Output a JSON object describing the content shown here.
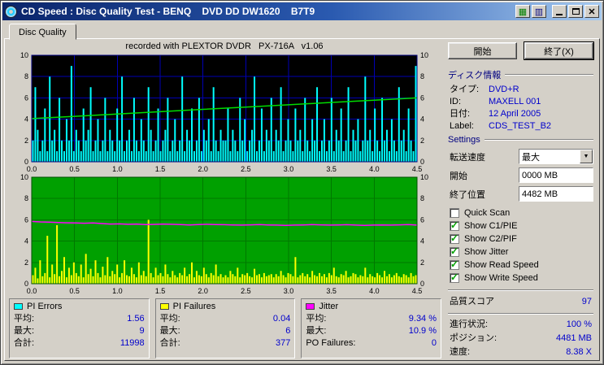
{
  "window": {
    "title": "CD Speed : Disc Quality Test - BENQ    DVD DD DW1620    B7T9"
  },
  "tab": {
    "label": "Disc Quality"
  },
  "recorded_with": "recorded with PLEXTOR DVDR   PX-716A   v1.06",
  "buttons": {
    "start": "開始",
    "exit": "終了(X)"
  },
  "disc_info": {
    "header": "ディスク情報",
    "rows": [
      {
        "label": "タイプ:",
        "value": "DVD+R"
      },
      {
        "label": "ID:",
        "value": "MAXELL 001"
      },
      {
        "label": "日付:",
        "value": "12 April 2005"
      },
      {
        "label": "Label:",
        "value": "CDS_TEST_B2"
      }
    ]
  },
  "settings": {
    "header": "Settings",
    "transfer_speed_label": "転送速度",
    "transfer_speed_value": "最大",
    "start_label": "開始",
    "start_value": "0000 MB",
    "end_label": "終了位置",
    "end_value": "4482 MB",
    "checkboxes": [
      {
        "label": "Quick Scan",
        "checked": false
      },
      {
        "label": "Show C1/PIE",
        "checked": true
      },
      {
        "label": "Show C2/PIF",
        "checked": true
      },
      {
        "label": "Show Jitter",
        "checked": true
      },
      {
        "label": "Show Read Speed",
        "checked": true
      },
      {
        "label": "Show Write Speed",
        "checked": true
      }
    ]
  },
  "score": {
    "label": "品質スコア",
    "value": "97"
  },
  "status": [
    {
      "label": "進行状況:",
      "value": "100 %"
    },
    {
      "label": "ポジション:",
      "value": "4481 MB"
    },
    {
      "label": "速度:",
      "value": "8.38 X"
    }
  ],
  "legend": {
    "boxes": [
      {
        "name": "PI Errors",
        "swatch": "#00ffff",
        "rows": [
          {
            "label": "平均:",
            "value": "1.56"
          },
          {
            "label": "最大:",
            "value": "9"
          },
          {
            "label": "合計:",
            "value": "11998"
          }
        ]
      },
      {
        "name": "PI Failures",
        "swatch": "#ffff00",
        "rows": [
          {
            "label": "平均:",
            "value": "0.04"
          },
          {
            "label": "最大:",
            "value": "6"
          },
          {
            "label": "合計:",
            "value": "377"
          }
        ]
      },
      {
        "name": "Jitter",
        "swatch": "#ff00ff",
        "rows": [
          {
            "label": "平均:",
            "value": "9.34 %"
          },
          {
            "label": "最大:",
            "value": "10.9 %"
          },
          {
            "label": "PO Failures:",
            "value": "0"
          }
        ]
      }
    ]
  },
  "chart_data": [
    {
      "type": "bar",
      "xlim": [
        0,
        4.5
      ],
      "ylim": [
        0,
        10
      ],
      "xticks": [
        "0.0",
        "0.5",
        "1.0",
        "1.5",
        "2.0",
        "2.5",
        "3.0",
        "3.5",
        "4.0",
        "4.5"
      ],
      "yticks": [
        0,
        2,
        4,
        6,
        8,
        10
      ],
      "bg": "#000000",
      "grid": "#0000b4",
      "border": "#000080",
      "series": [
        {
          "name": "PI Errors",
          "type": "bars",
          "color": "#00ffff",
          "values": [
            2,
            7,
            3,
            1,
            2,
            5,
            1,
            8,
            2,
            3,
            1,
            6,
            2,
            1,
            4,
            2,
            9,
            1,
            3,
            2,
            1,
            5,
            2,
            3,
            7,
            1,
            2,
            4,
            1,
            2,
            6,
            1,
            3,
            2,
            1,
            5,
            2,
            8,
            1,
            2,
            3,
            1,
            6,
            2,
            1,
            4,
            2,
            1,
            7,
            3,
            1,
            2,
            5,
            1,
            2,
            3,
            6,
            1,
            2,
            4,
            1,
            2,
            8,
            1,
            3,
            2,
            5,
            1,
            2,
            6,
            1,
            3,
            2,
            4,
            1,
            7,
            2,
            1,
            3,
            2,
            2,
            5,
            1,
            3,
            2,
            1,
            6,
            2,
            4,
            1,
            2,
            3,
            8,
            1,
            2,
            5,
            1,
            3,
            2,
            6,
            1,
            3,
            2,
            7,
            1,
            2,
            4,
            2,
            1,
            5,
            2,
            3,
            1,
            6,
            2,
            1,
            4,
            2,
            7,
            1,
            2,
            4,
            1,
            2,
            6,
            1,
            3,
            2,
            5,
            1,
            2,
            7,
            1,
            3,
            2,
            4,
            1,
            2,
            8,
            2,
            3,
            1,
            5,
            2,
            1,
            6,
            2,
            3,
            1,
            4,
            2,
            1,
            7,
            2,
            3,
            1,
            5,
            2,
            1,
            9
          ]
        },
        {
          "name": "Write Speed",
          "type": "line",
          "color": "#00dc00",
          "values": [
            4.05,
            4.27,
            4.48,
            4.7,
            4.92,
            5.13,
            5.35,
            5.57,
            5.78,
            6.0
          ]
        }
      ]
    },
    {
      "type": "bar",
      "xlim": [
        0,
        4.5
      ],
      "ylim": [
        0,
        10
      ],
      "xticks": [
        "0.0",
        "0.5",
        "1.0",
        "1.5",
        "2.0",
        "2.5",
        "3.0",
        "3.5",
        "4.0",
        "4.5"
      ],
      "yticks": [
        0,
        2,
        4,
        6,
        8,
        10
      ],
      "bg": "#00a000",
      "grid": "#007800",
      "border": "#005000",
      "series": [
        {
          "name": "PI Failures",
          "type": "bars",
          "color": "#ffff00",
          "values": [
            0.8,
            1.5,
            0.5,
            2.2,
            0.7,
            1.0,
            4.5,
            0.6,
            1.8,
            0.9,
            5.5,
            0.7,
            1.2,
            2.5,
            0.6,
            1.5,
            0.8,
            2.0,
            1.0,
            0.7,
            1.8,
            0.6,
            2.8,
            0.9,
            1.4,
            0.7,
            2.2,
            1.0,
            0.6,
            1.6,
            0.8,
            2.5,
            0.7,
            1.2,
            0.9,
            1.8,
            0.6,
            1.0,
            2.2,
            0.8,
            0.7,
            1.5,
            0.9,
            0.6,
            2.0,
            0.8,
            1.2,
            0.7,
            6.0,
            1.0,
            0.6,
            1.5,
            0.8,
            1.0,
            0.7,
            1.8,
            0.9,
            0.6,
            1.2,
            0.8,
            0.6,
            1.0,
            0.8,
            1.5,
            0.7,
            0.9,
            2.0,
            0.6,
            1.2,
            0.8,
            0.7,
            1.5,
            0.9,
            0.6,
            1.0,
            0.8,
            1.8,
            0.7,
            0.9,
            0.6,
            0.8,
            0.6,
            1.2,
            0.9,
            0.7,
            1.5,
            0.6,
            0.9,
            0.8,
            1.0,
            0.7,
            0.6,
            1.4,
            0.8,
            0.9,
            0.6,
            1.0,
            0.7,
            0.8,
            0.9,
            0.6,
            0.9,
            0.7,
            1.2,
            0.8,
            0.6,
            1.0,
            0.9,
            0.7,
            2.5,
            0.6,
            0.8,
            1.0,
            0.7,
            0.9,
            0.6,
            1.2,
            0.8,
            0.7,
            1.0,
            0.7,
            0.9,
            0.6,
            1.0,
            0.8,
            1.5,
            0.7,
            0.6,
            0.9,
            0.8,
            1.2,
            0.6,
            0.7,
            1.0,
            0.9,
            0.6,
            0.8,
            0.7,
            1.5,
            0.6,
            0.9,
            0.7,
            0.6,
            1.0,
            0.8,
            0.6,
            1.2,
            0.7,
            0.9,
            0.6,
            0.8,
            1.0,
            0.7,
            0.6,
            0.9,
            0.8,
            0.6,
            1.0,
            0.7,
            0.8
          ]
        },
        {
          "name": "Jitter",
          "type": "line",
          "color": "#ff00ff",
          "values": [
            5.85,
            5.8,
            5.78,
            5.75,
            5.72,
            5.7,
            5.68,
            5.7,
            5.65,
            5.6,
            5.62,
            5.58,
            5.6,
            5.55,
            5.57,
            5.6,
            5.58,
            5.55,
            5.52,
            5.55,
            5.58,
            5.56,
            5.54,
            5.52,
            5.5,
            5.53,
            5.55,
            5.52,
            5.5,
            5.48,
            5.5,
            5.52,
            5.55,
            5.53,
            5.5,
            5.52,
            5.54,
            5.5,
            5.48,
            5.5,
            5.52,
            5.5,
            5.53,
            5.55,
            5.5
          ]
        }
      ]
    }
  ]
}
